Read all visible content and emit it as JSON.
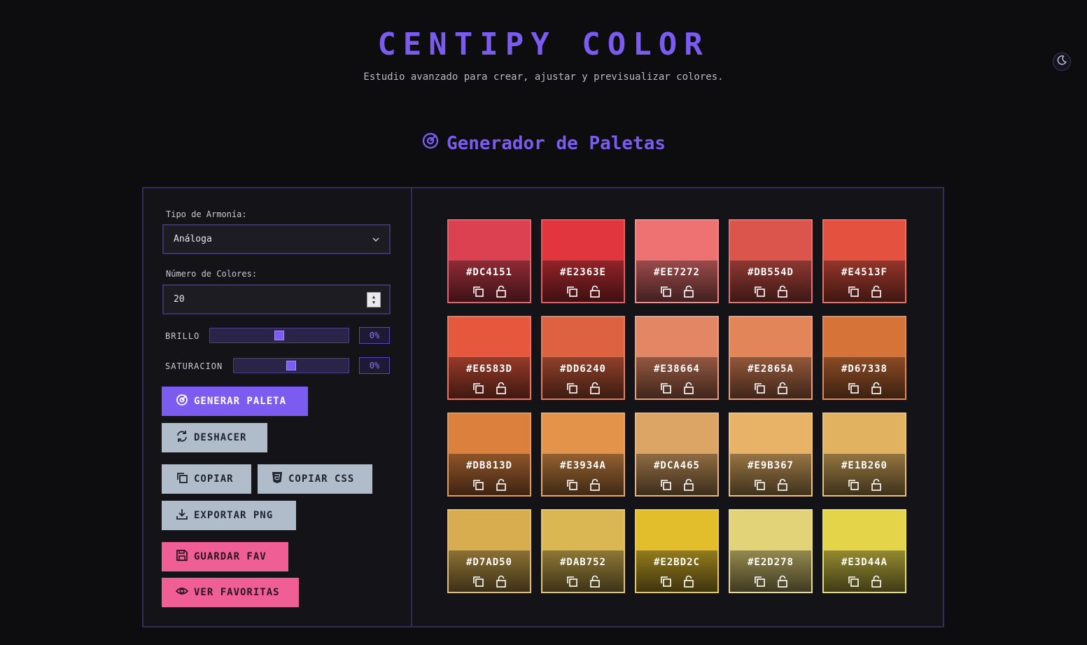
{
  "header": {
    "title": "CENTIPY COLOR",
    "subtitle": "Estudio avanzado para crear, ajustar y previsualizar colores."
  },
  "section": {
    "title": "Generador de Paletas"
  },
  "controls": {
    "harmony_label": "Tipo de Armonía:",
    "harmony_value": "Análoga",
    "count_label": "Número de Colores:",
    "count_value": "20",
    "brightness_label": "BRILLO",
    "brightness_value": "0%",
    "brightness_level": 0.5,
    "saturation_label": "SATURACION",
    "saturation_value": "0%",
    "saturation_level": 0.5
  },
  "buttons": {
    "generate": "GENERAR PALETA",
    "undo": "DESHACER",
    "copy": "COPIAR",
    "copy_css": "COPIAR CSS",
    "export_png": "EXPORTAR PNG",
    "save_fav": "GUARDAR FAV",
    "view_favs": "VER FAVORITAS"
  },
  "colors": {
    "accent": "#7C5CF0",
    "secondary_button": "#B1BCCB",
    "pink_button": "#EF5F95",
    "background": "#0D0D10"
  },
  "palette": [
    {
      "hex": "#DC4151",
      "border": "#E2646F"
    },
    {
      "hex": "#E2363E",
      "border": "#E85A60"
    },
    {
      "hex": "#EE7272",
      "border": "#F28C8C"
    },
    {
      "hex": "#DB554D",
      "border": "#E3746D"
    },
    {
      "hex": "#E4513F",
      "border": "#EA6F60"
    },
    {
      "hex": "#E6583D",
      "border": "#EC755F"
    },
    {
      "hex": "#DD6240",
      "border": "#E47E61"
    },
    {
      "hex": "#E38664",
      "border": "#E89E81"
    },
    {
      "hex": "#E2865A",
      "border": "#E89E7A"
    },
    {
      "hex": "#D67338",
      "border": "#DF8D5B"
    },
    {
      "hex": "#DB813D",
      "border": "#E39A5F"
    },
    {
      "hex": "#E3934A",
      "border": "#E9A96B"
    },
    {
      "hex": "#DCA465",
      "border": "#E3B683"
    },
    {
      "hex": "#E9B367",
      "border": "#EEC386"
    },
    {
      "hex": "#E1B260",
      "border": "#E7C27F"
    },
    {
      "hex": "#D7AD50",
      "border": "#DFBE71"
    },
    {
      "hex": "#DAB752",
      "border": "#E2C673"
    },
    {
      "hex": "#E2BD2C",
      "border": "#E8CA53"
    },
    {
      "hex": "#E2D278",
      "border": "#E8DC93"
    },
    {
      "hex": "#E3D44A",
      "border": "#E9DD6E"
    }
  ]
}
